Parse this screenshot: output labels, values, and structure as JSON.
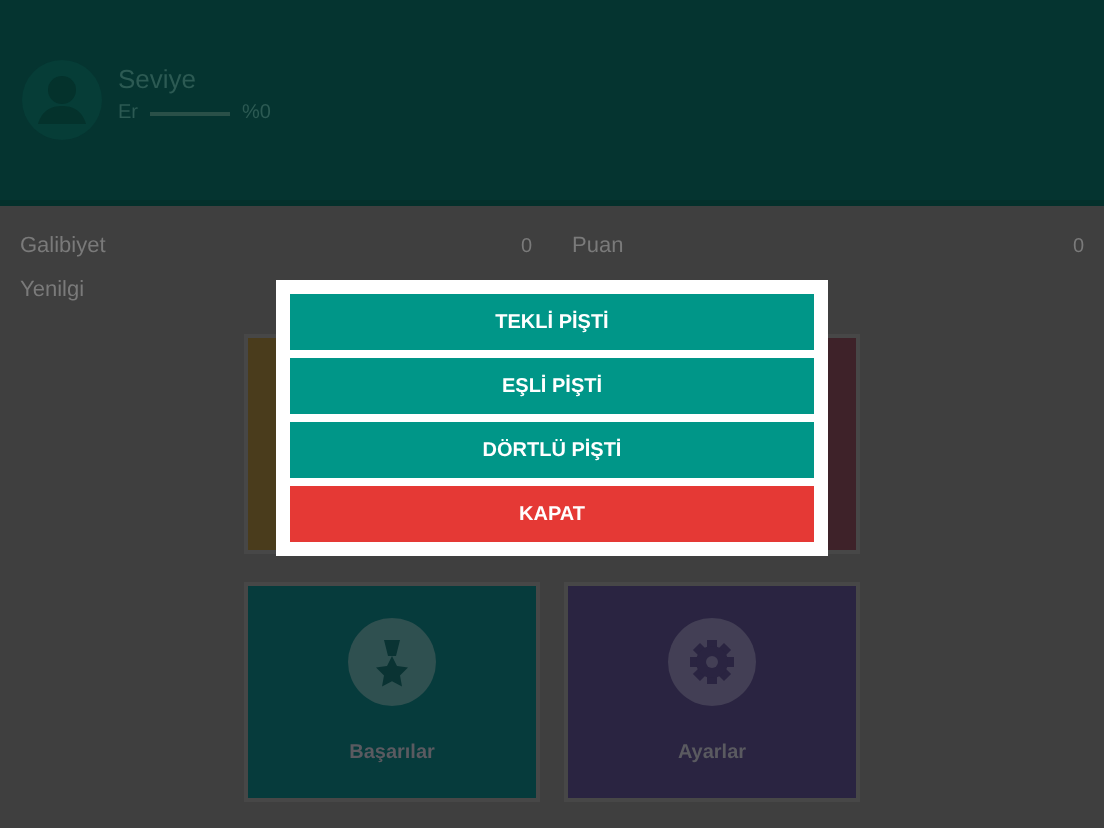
{
  "profile": {
    "title": "Seviye",
    "rank": "Er",
    "level": 0,
    "percent": "%0"
  },
  "stats": [
    {
      "label": "Galibiyet",
      "value": "0"
    },
    {
      "label": "Puan",
      "value": "0"
    },
    {
      "label": "Yenilgi"
    }
  ],
  "tiles": [
    {
      "color": "#4a3c1c"
    },
    {
      "color": "#3e2229"
    },
    {
      "label": "Başarılar",
      "kind": "medal",
      "color": "#063b3c"
    },
    {
      "label": "Ayarlar",
      "kind": "gear",
      "color": "#2a2441"
    }
  ],
  "dialog": {
    "buttons": [
      {
        "label": "TEKLİ PİŞTİ",
        "kind": "primary"
      },
      {
        "label": "EŞLİ PİŞTİ",
        "kind": "primary"
      },
      {
        "label": "DÖRTLÜ PİŞTİ",
        "kind": "primary"
      },
      {
        "label": "KAPAT",
        "kind": "danger"
      }
    ]
  }
}
